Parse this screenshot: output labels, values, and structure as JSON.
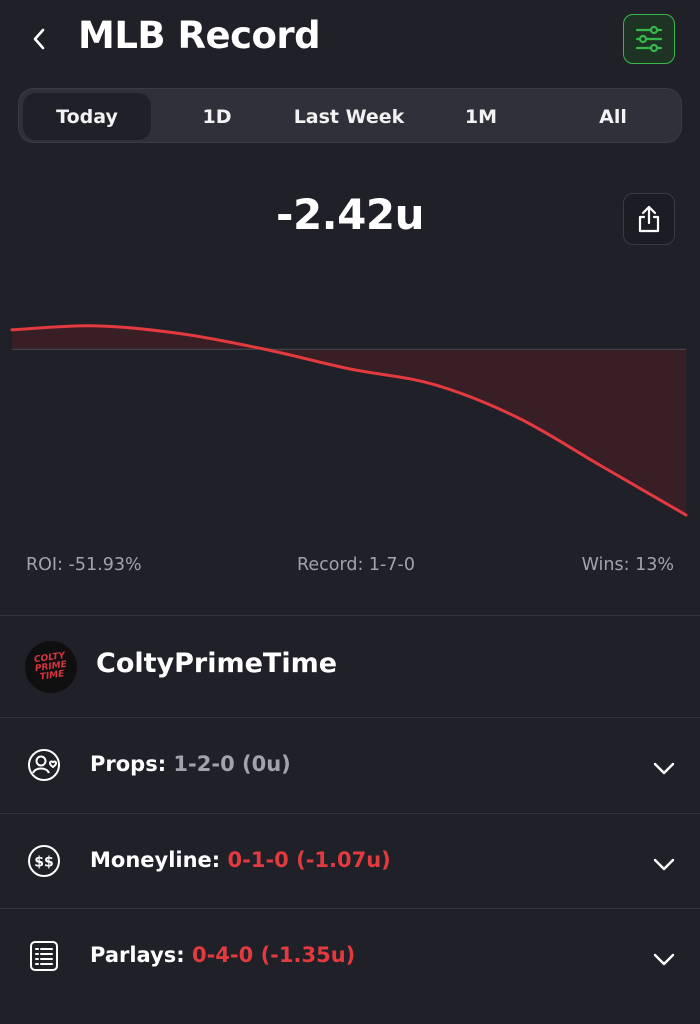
{
  "header": {
    "title": "MLB Record",
    "back_icon": "chevron-left-icon",
    "filter_icon": "sliders-icon",
    "accent_color": "#36b94a"
  },
  "tabs": [
    {
      "label": "Today",
      "active": true
    },
    {
      "label": "1D",
      "active": false
    },
    {
      "label": "Last Week",
      "active": false
    },
    {
      "label": "1M",
      "active": false
    },
    {
      "label": "All",
      "active": false
    }
  ],
  "balance": {
    "value": "-2.42u",
    "share_icon": "share-icon"
  },
  "chart_data": {
    "type": "area",
    "series": [
      {
        "values": [
          0.1,
          0.12,
          0.08,
          0,
          -0.1,
          -0.18,
          -0.35,
          -0.6,
          -0.85
        ]
      }
    ],
    "baseline": 0,
    "grid": false,
    "line_color": "#e23a3f",
    "fill_color": "#3a1f25"
  },
  "stats": {
    "roi": "ROI: -51.93%",
    "record": "Record: 1-7-0",
    "wins": "Wins: 13%"
  },
  "profile": {
    "name": "ColtyPrimeTime",
    "avatar_text": "COLTY PRIME TIME"
  },
  "rows": [
    {
      "label": "Props:",
      "value": "1-2-0 (0u)",
      "status": "neutral",
      "icon": "user-heart-icon"
    },
    {
      "label": "Moneyline:",
      "value": "0-1-0 (-1.07u)",
      "status": "negative",
      "icon": "dollar-circle-icon"
    },
    {
      "label": "Parlays:",
      "value": "0-4-0 (-1.35u)",
      "status": "negative",
      "icon": "list-icon"
    }
  ]
}
